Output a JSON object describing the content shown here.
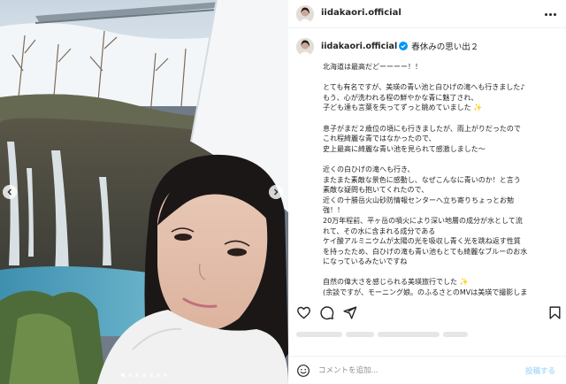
{
  "post": {
    "username": "iidakaori.official",
    "verified": true,
    "title": "春休みの思い出２"
  },
  "caption": [
    "北海道は最高だどーーーー！！",
    "",
    "とても有名ですが、美瑛の青い池と白ひげの滝へも行きました♪",
    "もう、心が洗われる程の鮮やかな青に魅了され、",
    "子ども達も言葉を失ってずっと眺めていました",
    "",
    "息子がまだ２歳位の頃にも行きましたが、雨上がりだったので",
    "これ程綺麗な青ではなかったので、",
    "史上最高に綺麗な青い池を見られて感激しました〜",
    "",
    "近くの白ひげの滝へも行き、",
    "またまた素敵な景色に感動し、なぜこんなに青いのか！と言う",
    "素敵な疑問も抱いてくれたので、",
    "近くの十勝岳火山砂防情報センターへ立ち寄りちょっとお勉",
    "強！！",
    "20万年程前、平ヶ岳の噴火により深い地層の成分が水として流",
    "れて、その水に含まれる成分である",
    "ケイ酸アルミニウムが太陽の光を吸収し青く光を跳ね返す性質",
    "を持ったため、白ひげの滝も青い池もとても綺麗なブルーのお水",
    "になっているみたいですね",
    "",
    "自然の偉大さを感じられる美瑛旅行でした",
    "(余談ですが、モーニング娘。のふるさとのMVは美瑛で撮影しま"
  ],
  "sparkle_lines": [
    4,
    21
  ],
  "comment": {
    "placeholder": "コメントを追加...",
    "value": "",
    "post_label": "投稿する"
  },
  "carousel": {
    "total": 7,
    "active": 1
  },
  "icons": {
    "like": "heart-icon",
    "comment": "comment-icon",
    "share": "send-icon",
    "save": "bookmark-icon",
    "emoji": "smiley-icon",
    "more": "more-options-icon",
    "prev": "chevron-left-icon",
    "next": "chevron-right-icon"
  },
  "colors": {
    "accent": "#0095f6",
    "post_button": "#b2dffc",
    "text": "#262626",
    "muted": "#8e8e8e",
    "divider": "#efefef"
  }
}
